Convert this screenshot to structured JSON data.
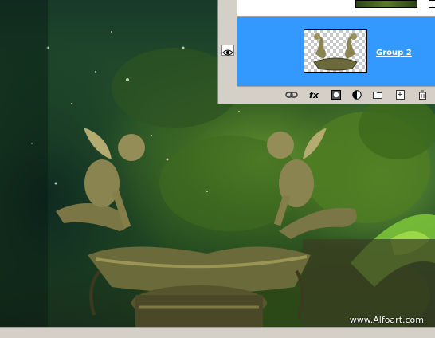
{
  "canvas": {
    "watermark": "www.Alfoart.com"
  },
  "layers_panel": {
    "selected_layer": {
      "name": "Group 2",
      "visible": true
    },
    "toolbar": {
      "icons": [
        "link-icon",
        "fx-icon",
        "mask-icon",
        "adjustment-icon",
        "folder-icon",
        "new-layer-icon",
        "trash-icon"
      ],
      "fx_label": "fx"
    }
  },
  "colors": {
    "selection": "#3399ff",
    "panel": "#d4d0c8"
  }
}
